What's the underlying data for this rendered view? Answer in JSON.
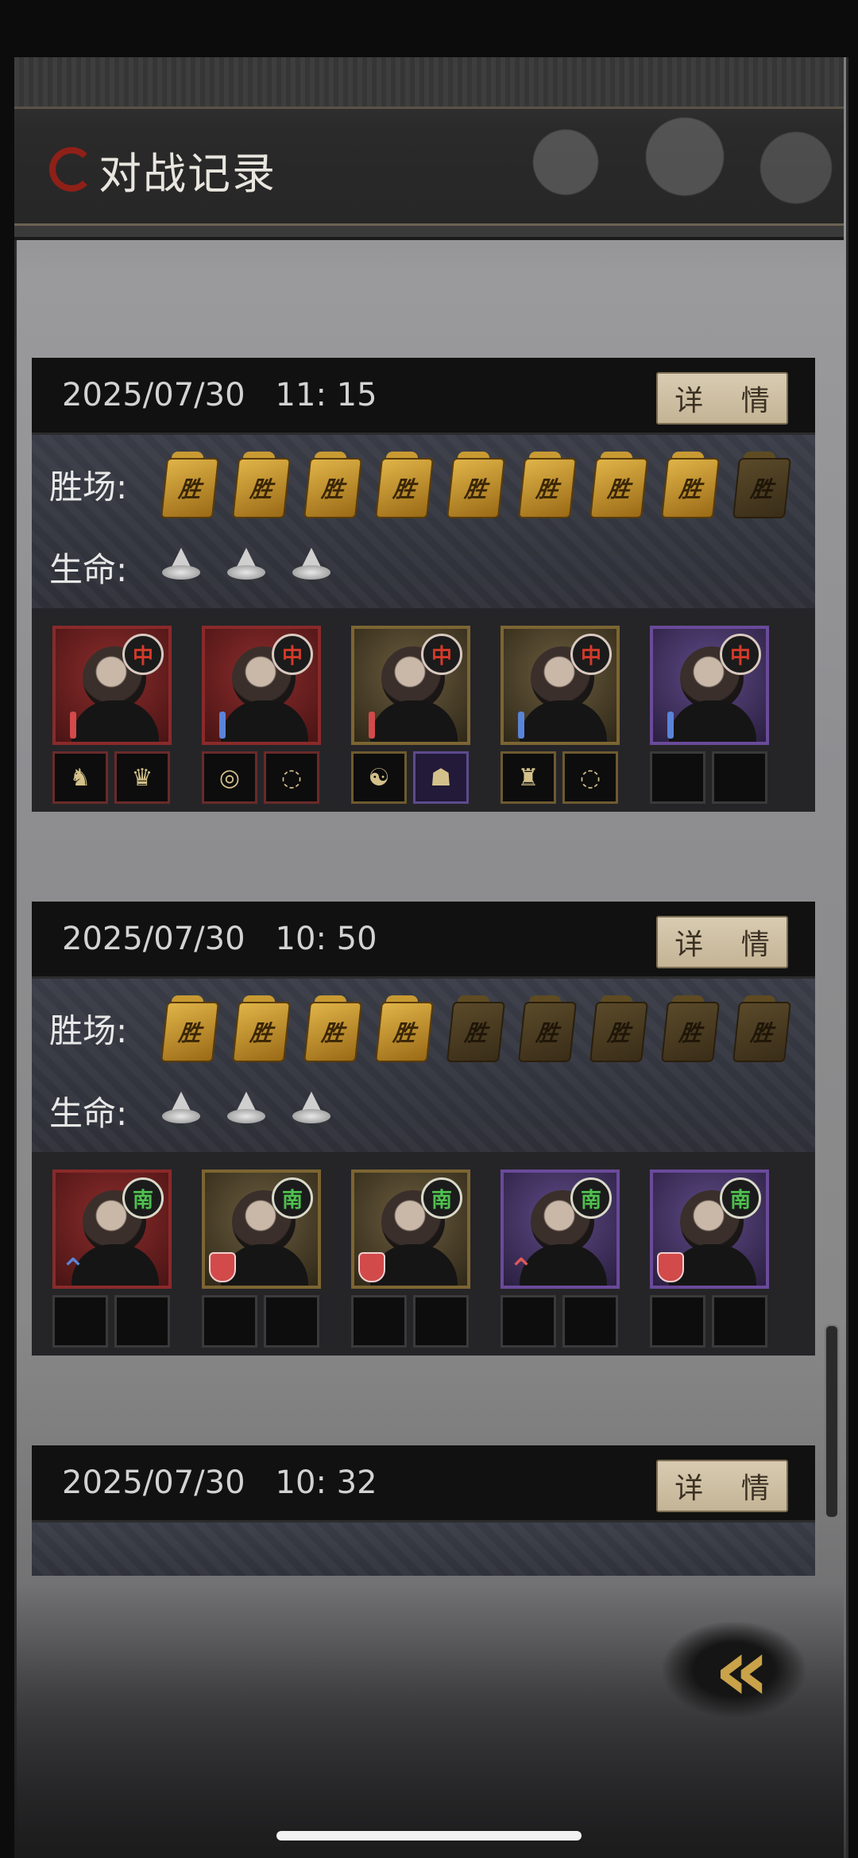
{
  "header": {
    "title": "对战记录"
  },
  "labels": {
    "wins": "胜场:",
    "lives": "生命:"
  },
  "records": [
    {
      "date": "2025/07/30",
      "time": "11: 15",
      "detail_label": "详 情",
      "wins_total": 9,
      "wins_won": 8,
      "win_glyph": "胜",
      "lives": 3,
      "units": [
        {
          "badge": "中",
          "badge_color": "red",
          "frame": "red",
          "class_icon": "red-sword-icon",
          "items": [
            "boots-icon",
            "dragon-icon"
          ]
        },
        {
          "badge": "中",
          "badge_color": "red",
          "frame": "red",
          "class_icon": "blue-sword-icon",
          "items": [
            "necklace-icon",
            "ring-icon"
          ]
        },
        {
          "badge": "中",
          "badge_color": "red",
          "frame": "gold",
          "class_icon": "red-sword-icon",
          "items": [
            "yin-yang-icon",
            "mask-icon"
          ]
        },
        {
          "badge": "中",
          "badge_color": "red",
          "frame": "gold",
          "class_icon": "blue-sword-icon",
          "items": [
            "pouch-icon",
            "ring-icon"
          ]
        },
        {
          "badge": "中",
          "badge_color": "red",
          "frame": "purple",
          "class_icon": "blue-sword-icon",
          "items": [
            "",
            ""
          ]
        }
      ]
    },
    {
      "date": "2025/07/30",
      "time": "10: 50",
      "detail_label": "详 情",
      "wins_total": 9,
      "wins_won": 4,
      "win_glyph": "胜",
      "lives": 3,
      "units": [
        {
          "badge": "南",
          "badge_color": "green",
          "frame": "red",
          "class_icon": "blue-chevron-icon",
          "items": [
            "",
            ""
          ]
        },
        {
          "badge": "南",
          "badge_color": "green",
          "frame": "gold",
          "class_icon": "shield-icon",
          "items": [
            "",
            ""
          ]
        },
        {
          "badge": "南",
          "badge_color": "green",
          "frame": "gold",
          "class_icon": "shield-icon",
          "items": [
            "",
            ""
          ]
        },
        {
          "badge": "南",
          "badge_color": "green",
          "frame": "purple",
          "class_icon": "red-chevron-icon",
          "items": [
            "",
            ""
          ]
        },
        {
          "badge": "南",
          "badge_color": "green",
          "frame": "purple",
          "class_icon": "shield-icon",
          "items": [
            "",
            ""
          ]
        }
      ]
    },
    {
      "date": "2025/07/30",
      "time": "10: 32",
      "detail_label": "详 情"
    }
  ],
  "colors": {
    "accent_gold": "#c9a24a",
    "badge_red": "#d43a2a",
    "badge_green": "#4fc04f"
  },
  "back_button": {
    "icon": "double-chevron-left-icon"
  }
}
